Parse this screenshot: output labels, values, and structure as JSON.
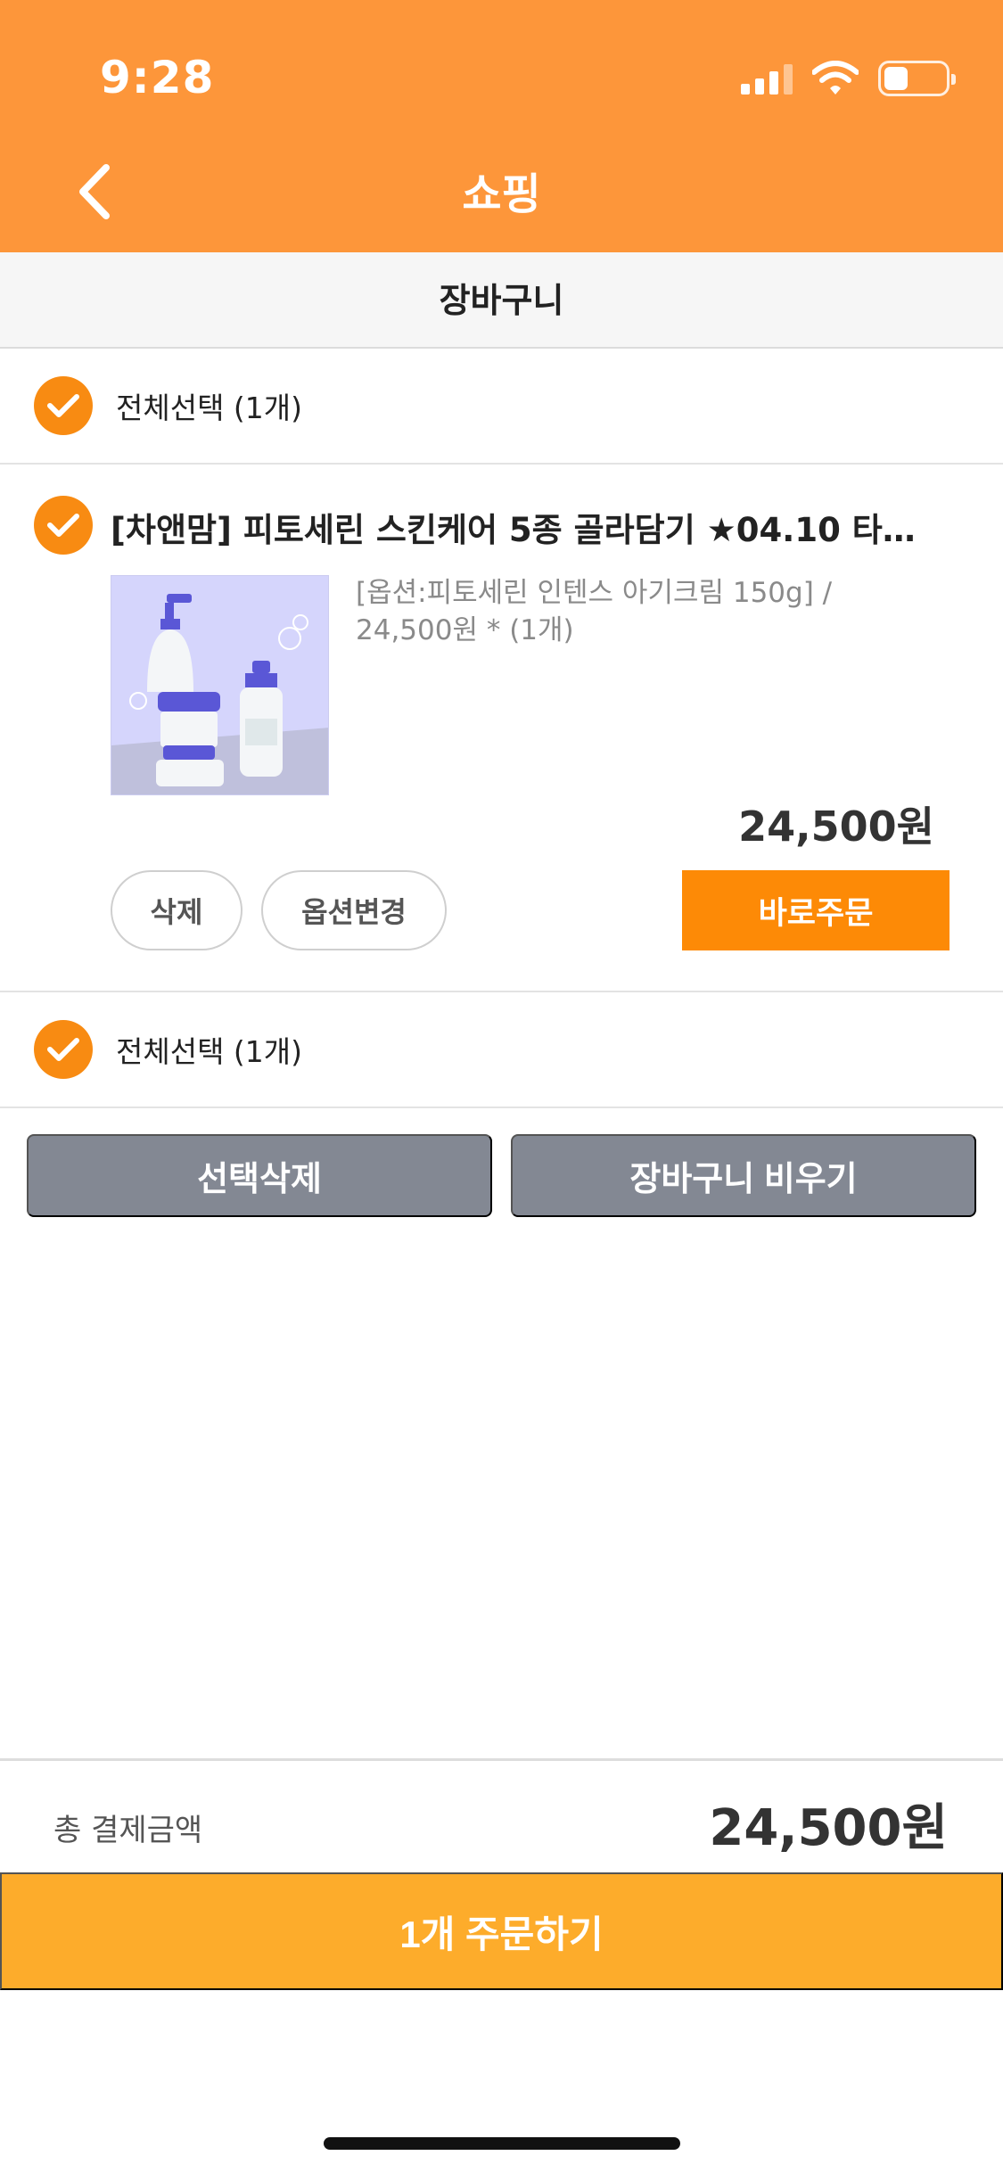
{
  "status_bar": {
    "time": "9:28"
  },
  "header": {
    "title": "쇼핑"
  },
  "subheader": {
    "title": "장바구니"
  },
  "select_all": {
    "label": "전체선택 (1개)"
  },
  "cart_items": [
    {
      "title": "[차앤맘] 피토세린 스킨케어 5종 골라담기 ★04.10 타…",
      "option_text": "[옵션:피토세린 인텐스 아기크림 150g] / 24,500원 * (1개)",
      "price": "24,500원",
      "delete_label": "삭제",
      "change_option_label": "옵션변경",
      "buy_now_label": "바로주문"
    }
  ],
  "actions": {
    "delete_selected_label": "선택삭제",
    "empty_cart_label": "장바구니 비우기"
  },
  "summary": {
    "total_label": "총 결제금액",
    "total_value": "24,500원",
    "order_button_label": "1개 주문하기"
  },
  "icons": [
    "chevron-left-icon",
    "checkmark-icon",
    "signal-icon",
    "wifi-icon",
    "battery-icon"
  ],
  "colors": {
    "header_bg": "#fd963a",
    "accent_orange": "#fd8a06",
    "checkbox": "#f88b12",
    "gray_button": "#838893",
    "order_button": "#fdac2b"
  }
}
